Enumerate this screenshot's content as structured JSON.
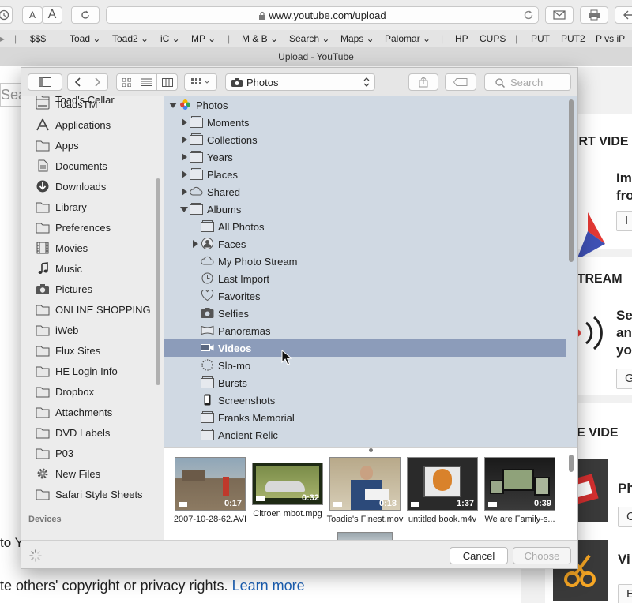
{
  "browser": {
    "address": "www.youtube.com/upload",
    "window_title": "Upload - YouTube",
    "reader_small": "A",
    "reader_large": "A",
    "bookmarks": [
      "$$$",
      "Toad",
      "Toad2",
      "iC",
      "MP",
      "M & B",
      "Search",
      "Maps",
      "Palomar",
      "HP",
      "CUPS",
      "PUT",
      "PUT2",
      "P vs iP"
    ]
  },
  "page": {
    "search_fragment": "Sear",
    "right_heads": [
      "ORT VIDE",
      "STREAM",
      "ATE VIDE"
    ],
    "right_texts": [
      "Im\nfro",
      "Se\nan\nyo",
      "Ph",
      "Vi"
    ],
    "right_btns": [
      "I",
      "G",
      "C",
      "E"
    ],
    "left_to": "to Y",
    "bottom_text": "te others' copyright or privacy rights.",
    "bottom_link": "Learn more"
  },
  "dialog": {
    "location": "Photos",
    "search_placeholder": "Search",
    "sidebar": {
      "items": [
        "Toad's Cellar",
        "ToadsTM",
        "Applications",
        "Apps",
        "Documents",
        "Downloads",
        "Library",
        "Preferences",
        "Movies",
        "Music",
        "Pictures",
        "ONLINE SHOPPING",
        "iWeb",
        "Flux Sites",
        "HE Login Info",
        "Dropbox",
        "Attachments",
        "DVD Labels",
        "P03",
        "New Files",
        "Safari Style Sheets"
      ],
      "devices_heading": "Devices"
    },
    "outline": {
      "root": "Photos",
      "rows": [
        "Moments",
        "Collections",
        "Years",
        "Places",
        "Shared",
        "Albums",
        "All Photos",
        "Faces",
        "My Photo Stream",
        "Last Import",
        "Favorites",
        "Selfies",
        "Panoramas",
        "Videos",
        "Slo-mo",
        "Bursts",
        "Screenshots",
        "Franks Memorial",
        "Ancient Relic"
      ],
      "selected": "Videos"
    },
    "thumbnails": [
      {
        "name": "2007-10-28-62.AVI",
        "duration": "0:17"
      },
      {
        "name": "Citroen mbot.mpg",
        "duration": "0:32"
      },
      {
        "name": "Toadie's Finest.mov",
        "duration": "0:18"
      },
      {
        "name": "untitled book.m4v",
        "duration": "1:37"
      },
      {
        "name": "We are Family-s...",
        "duration": "0:39"
      }
    ],
    "cancel_label": "Cancel",
    "choose_label": "Choose"
  }
}
